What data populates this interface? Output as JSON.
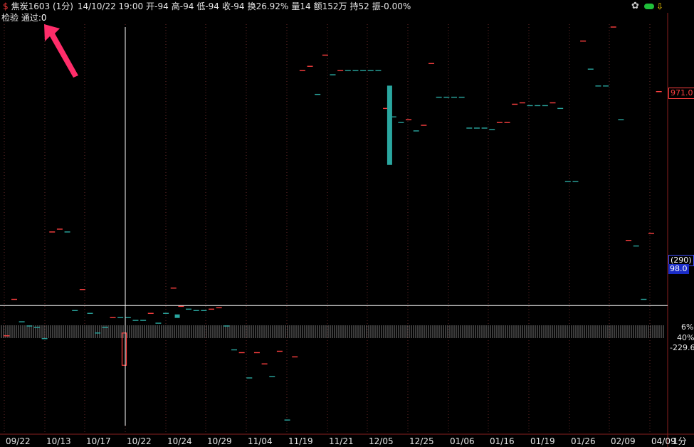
{
  "header": {
    "symbol_mark": "$",
    "instrument": "焦炭1603 (1分)",
    "datetime": "14/10/22 19:00",
    "fields": [
      "开-94",
      "高-94",
      "低-94",
      "收-94",
      "换26.92%",
      "量14",
      "额152万",
      "持52",
      "振-0.00%"
    ]
  },
  "subheader": {
    "label": "检验 通过:",
    "value": "0"
  },
  "toolbar": {
    "gear_icon": "gear-icon",
    "green_pill_icon": "green-pill-icon",
    "yellow_arrow_icon": "yellow-arrow-icon"
  },
  "annotation": {
    "arrow_icon": "pink-arrow-icon",
    "arrow_color": "#ff2d6a"
  },
  "right_axis": {
    "top_price": "971.0",
    "cursor_top": "(290)",
    "cursor_bottom": "98.0",
    "pct_1": "6%",
    "pct_2": "40%",
    "value_low": "-229.6"
  },
  "period_button": "1分",
  "colors": {
    "up": "#ff4040",
    "down": "#2aa7a0",
    "grid": "#6a2a2a",
    "crosshair": "#ffffff",
    "volume": "#777777"
  },
  "chart_data": {
    "type": "candlestick",
    "x_tick_labels": [
      "09/22",
      "10/13",
      "10/17",
      "10/22",
      "10/24",
      "10/29",
      "11/04",
      "11/19",
      "11/21",
      "12/05",
      "12/25",
      "01/06",
      "01/16",
      "01/19",
      "01/26",
      "02/09",
      "04/09"
    ],
    "cursor": {
      "date": "10/22",
      "value_label": "98.0"
    },
    "price_marks": [
      {
        "i": 0,
        "v": -10,
        "up": true
      },
      {
        "i": 1,
        "v": 120,
        "up": true
      },
      {
        "i": 2,
        "v": 40,
        "up": false
      },
      {
        "i": 3,
        "v": 25,
        "up": false
      },
      {
        "i": 4,
        "v": 20,
        "up": false
      },
      {
        "i": 5,
        "v": -20,
        "up": false
      },
      {
        "i": 6,
        "v": 360,
        "up": true
      },
      {
        "i": 7,
        "v": 370,
        "up": true
      },
      {
        "i": 8,
        "v": 360,
        "up": false
      },
      {
        "i": 9,
        "v": 80,
        "up": false
      },
      {
        "i": 10,
        "v": 155,
        "up": true
      },
      {
        "i": 11,
        "v": 70,
        "up": false
      },
      {
        "i": 12,
        "v": 0,
        "up": false
      },
      {
        "i": 13,
        "v": 20,
        "up": false
      },
      {
        "i": 14,
        "v": 55,
        "up": true
      },
      {
        "i": 15,
        "v": 55,
        "up": false
      },
      {
        "i": 16,
        "v": 55,
        "up": false
      },
      {
        "i": 17,
        "v": 45,
        "up": false
      },
      {
        "i": 18,
        "v": 45,
        "up": false
      },
      {
        "i": 19,
        "v": 70,
        "up": true
      },
      {
        "i": 20,
        "v": 35,
        "up": false
      },
      {
        "i": 21,
        "v": 70,
        "up": false
      },
      {
        "i": 22,
        "v": 160,
        "up": true
      },
      {
        "i": 23,
        "v": 95,
        "up": true
      },
      {
        "i": 24,
        "v": 85,
        "up": false
      },
      {
        "i": 25,
        "v": 80,
        "up": false
      },
      {
        "i": 26,
        "v": 80,
        "up": false
      },
      {
        "i": 27,
        "v": 85,
        "up": true
      },
      {
        "i": 28,
        "v": 90,
        "up": true
      },
      {
        "i": 29,
        "v": 25,
        "up": false
      },
      {
        "i": 30,
        "v": -60,
        "up": false
      },
      {
        "i": 31,
        "v": -70,
        "up": true
      },
      {
        "i": 32,
        "v": -160,
        "up": false
      },
      {
        "i": 33,
        "v": -70,
        "up": true
      },
      {
        "i": 34,
        "v": -110,
        "up": true
      },
      {
        "i": 35,
        "v": -155,
        "up": false
      },
      {
        "i": 36,
        "v": -65,
        "up": true
      },
      {
        "i": 37,
        "v": -310,
        "up": false
      },
      {
        "i": 38,
        "v": -85,
        "up": true
      },
      {
        "i": 39,
        "v": 935,
        "up": true
      },
      {
        "i": 40,
        "v": 950,
        "up": true
      },
      {
        "i": 41,
        "v": 850,
        "up": false
      },
      {
        "i": 42,
        "v": 990,
        "up": true
      },
      {
        "i": 43,
        "v": 920,
        "up": false
      },
      {
        "i": 44,
        "v": 935,
        "up": true
      },
      {
        "i": 45,
        "v": 935,
        "up": false
      },
      {
        "i": 46,
        "v": 935,
        "up": false
      },
      {
        "i": 47,
        "v": 935,
        "up": false
      },
      {
        "i": 48,
        "v": 935,
        "up": false
      },
      {
        "i": 49,
        "v": 935,
        "up": false
      },
      {
        "i": 50,
        "v": 800,
        "up": true
      },
      {
        "i": 51,
        "v": 770,
        "up": false
      },
      {
        "i": 52,
        "v": 750,
        "up": false
      },
      {
        "i": 53,
        "v": 760,
        "up": true
      },
      {
        "i": 54,
        "v": 720,
        "up": false
      },
      {
        "i": 55,
        "v": 740,
        "up": true
      },
      {
        "i": 56,
        "v": 960,
        "up": true
      },
      {
        "i": 57,
        "v": 840,
        "up": false
      },
      {
        "i": 58,
        "v": 840,
        "up": false
      },
      {
        "i": 59,
        "v": 840,
        "up": false
      },
      {
        "i": 60,
        "v": 840,
        "up": false
      },
      {
        "i": 61,
        "v": 730,
        "up": false
      },
      {
        "i": 62,
        "v": 730,
        "up": false
      },
      {
        "i": 63,
        "v": 730,
        "up": false
      },
      {
        "i": 64,
        "v": 725,
        "up": false
      },
      {
        "i": 65,
        "v": 750,
        "up": true
      },
      {
        "i": 66,
        "v": 750,
        "up": true
      },
      {
        "i": 67,
        "v": 815,
        "up": true
      },
      {
        "i": 68,
        "v": 820,
        "up": true
      },
      {
        "i": 69,
        "v": 810,
        "up": false
      },
      {
        "i": 70,
        "v": 810,
        "up": false
      },
      {
        "i": 71,
        "v": 810,
        "up": false
      },
      {
        "i": 72,
        "v": 820,
        "up": true
      },
      {
        "i": 73,
        "v": 800,
        "up": false
      },
      {
        "i": 74,
        "v": 540,
        "up": false
      },
      {
        "i": 75,
        "v": 540,
        "up": false
      },
      {
        "i": 76,
        "v": 1040,
        "up": true
      },
      {
        "i": 77,
        "v": 940,
        "up": false
      },
      {
        "i": 78,
        "v": 880,
        "up": false
      },
      {
        "i": 79,
        "v": 880,
        "up": false
      },
      {
        "i": 80,
        "v": 1090,
        "up": true
      },
      {
        "i": 81,
        "v": 760,
        "up": false
      },
      {
        "i": 82,
        "v": 330,
        "up": true
      },
      {
        "i": 83,
        "v": 310,
        "up": false
      },
      {
        "i": 84,
        "v": 120,
        "up": false
      },
      {
        "i": 85,
        "v": 355,
        "up": true
      },
      {
        "i": 86,
        "v": 860,
        "up": true
      }
    ],
    "bodies": [
      {
        "i": 15.5,
        "open": -115,
        "close": 0,
        "up": true
      },
      {
        "i": 22.5,
        "open": 65,
        "close": 55,
        "up": false
      },
      {
        "i": 50.5,
        "open": 880,
        "close": 600,
        "up": false
      }
    ],
    "y_range": [
      -330,
      1090
    ]
  }
}
